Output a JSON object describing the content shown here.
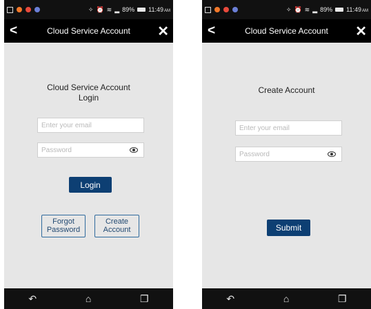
{
  "status_bar": {
    "battery": "89%",
    "time": "11:49",
    "am_pm": "AM"
  },
  "icons": {
    "back": "chevron-left-icon",
    "close": "x-close-icon",
    "eye": "eye-icon",
    "nav_back": "back-arrow-icon",
    "nav_home": "home-icon",
    "nav_recents": "recents-icon"
  },
  "colors": {
    "primary_button": "#0d3f73",
    "secondary_border": "#2f6a9d",
    "background": "#e6e6e6"
  },
  "screens": [
    {
      "title": "Cloud Service Account",
      "heading_line1": "Cloud Service Account",
      "heading_line2": "Login",
      "email_placeholder": "Enter your email",
      "password_placeholder": "Password",
      "primary_button": "Login",
      "forgot_line1": "Forgot",
      "forgot_line2": "Password",
      "create_line1": "Create",
      "create_line2": "Account"
    },
    {
      "title": "Cloud Service Account",
      "heading": "Create Account",
      "email_placeholder": "Enter your email",
      "password_placeholder": "Password",
      "primary_button": "Submit"
    }
  ]
}
